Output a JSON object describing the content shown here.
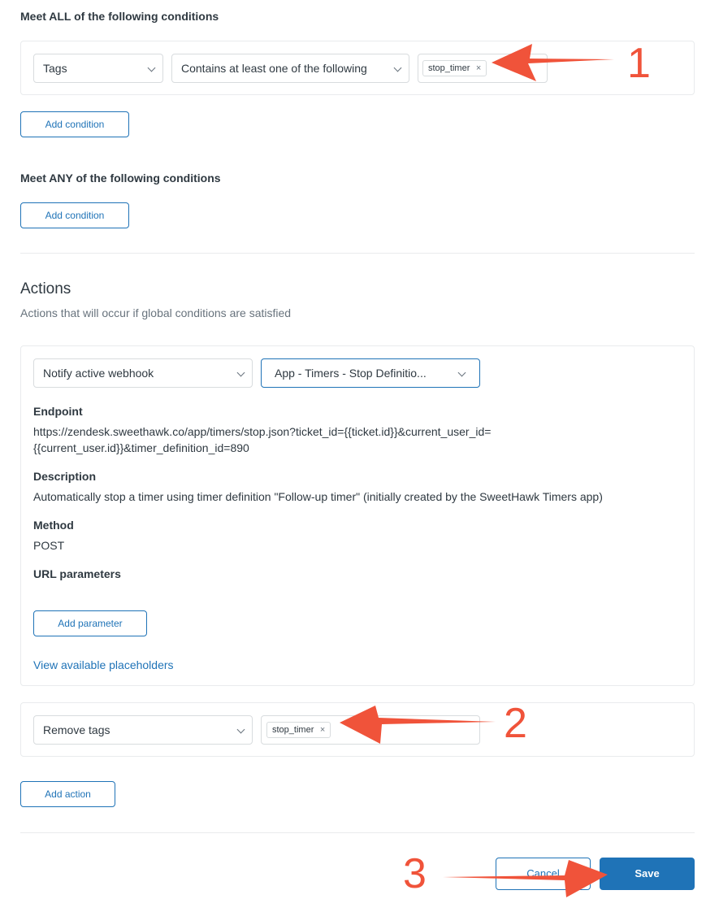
{
  "conditions": {
    "all_title": "Meet ALL of the following conditions",
    "all_field": "Tags",
    "all_operator": "Contains at least one of the following",
    "all_tag": "stop_timer",
    "add_condition_all": "Add condition",
    "any_title": "Meet ANY of the following conditions",
    "add_condition_any": "Add condition"
  },
  "actions": {
    "title": "Actions",
    "subtitle": "Actions that will occur if global conditions are satisfied",
    "action1_type": "Notify active webhook",
    "action1_target": "App - Timers - Stop Definitio...",
    "endpoint_label": "Endpoint",
    "endpoint_line1": "https://zendesk.sweethawk.co/app/timers/stop.json?ticket_id={{ticket.id}}&current_user_id=",
    "endpoint_line2": "{{current_user.id}}&timer_definition_id=890",
    "description_label": "Description",
    "description_value": "Automatically stop a timer using timer definition \"Follow-up timer\" (initially created by the SweetHawk Timers app)",
    "method_label": "Method",
    "method_value": "POST",
    "url_params_label": "URL parameters",
    "add_parameter": "Add parameter",
    "placeholders_link": "View available placeholders",
    "action2_type": "Remove tags",
    "action2_tag": "stop_timer",
    "add_action": "Add action"
  },
  "footer": {
    "cancel": "Cancel",
    "save": "Save"
  },
  "annotations": {
    "n1": "1",
    "n2": "2",
    "n3": "3",
    "color": "#f0533a"
  },
  "icons": {
    "tag_remove": "×"
  }
}
